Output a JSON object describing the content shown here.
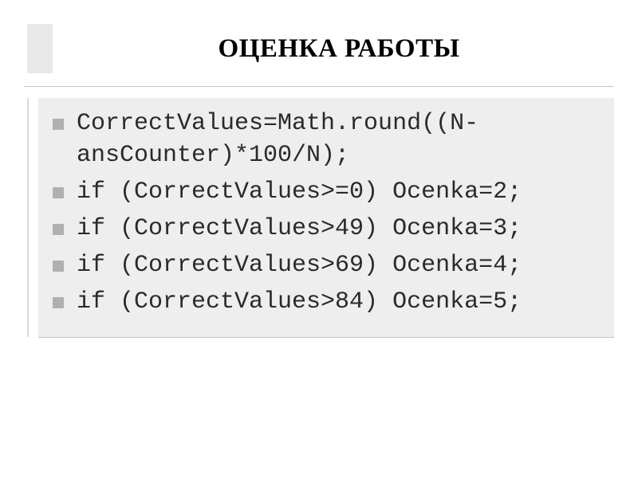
{
  "title": "ОЦЕНКА РАБОТЫ",
  "code_lines": [
    "CorrectValues=Math.round((N-ansCounter)*100/N);",
    "if (CorrectValues>=0) Ocenka=2;",
    "if (CorrectValues>49) Ocenka=3;",
    "if (CorrectValues>69) Ocenka=4;",
    "if (CorrectValues>84) Ocenka=5;"
  ]
}
